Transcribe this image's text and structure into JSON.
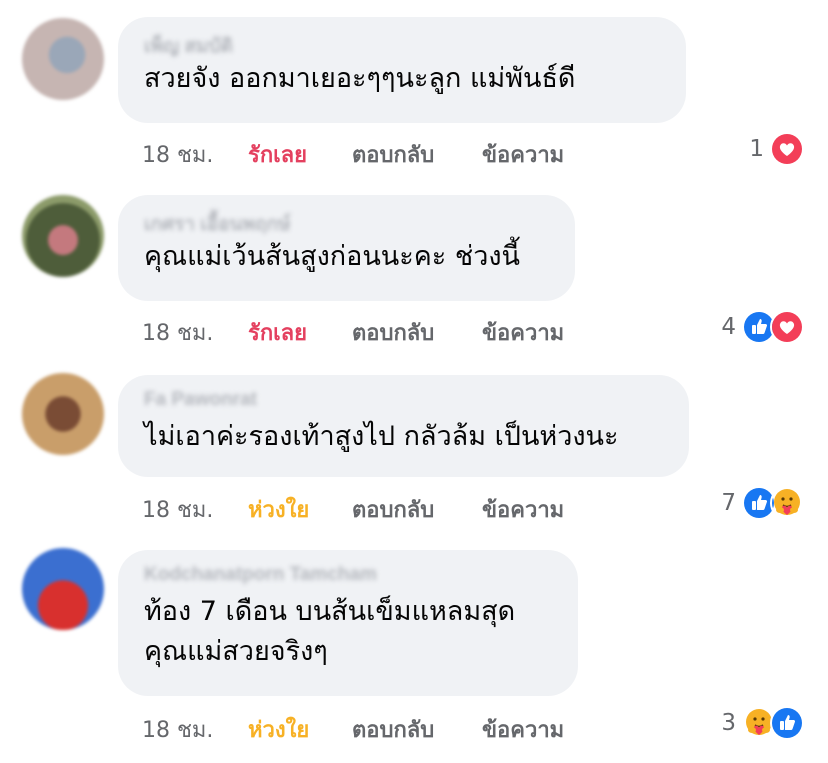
{
  "comments": [
    {
      "author": "เพ็ญ สมบัติ",
      "lines": [
        "สวยจัง   ออกมาเยอะๆๆนะลูก   แม่พันธ์ดี"
      ],
      "time": "18 ชม.",
      "reaction_label": "รักเลย",
      "reply_label": "ตอบกลับ",
      "message_label": "ข้อความ",
      "reaction_count": "1",
      "reaction_icons": [
        "love-icon"
      ],
      "avatar_colors": [
        "#b8a8a6",
        "#8e9aab"
      ]
    },
    {
      "author": "เกศรา เอื้อนพฤกษ์",
      "lines": [
        "คุณแม่เว้นส้นสูงก่อนนะคะ ช่วงนี้"
      ],
      "time": "18 ชม.",
      "reaction_label": "รักเลย",
      "reply_label": "ตอบกลับ",
      "message_label": "ข้อความ",
      "reaction_count": "4",
      "reaction_icons": [
        "like-icon",
        "love-icon"
      ],
      "avatar_colors": [
        "#6b7a4e",
        "#c45a6a"
      ]
    },
    {
      "author": "Fa Pawonrat",
      "lines": [
        "ไม่เอาค่ะรองเท้าสูงไป กลัวล้ม เป็นห่วงนะ"
      ],
      "time": "18 ชม.",
      "reaction_label": "ห่วงใย",
      "reply_label": "ตอบกลับ",
      "message_label": "ข้อความ",
      "reaction_count": "7",
      "reaction_icons": [
        "like-icon",
        "care-icon"
      ],
      "avatar_colors": [
        "#c9a272",
        "#6e4a35"
      ]
    },
    {
      "author": "Kodchanatporn Tamcham",
      "lines": [
        "ท้อง 7 เดือน บนส้นเข็มแหลมสุด",
        "คุณแม่สวยจริงๆ"
      ],
      "time": "18 ชม.",
      "reaction_label": "ห่วงใย",
      "reply_label": "ตอบกลับ",
      "message_label": "ข้อความ",
      "reaction_count": "3",
      "reaction_icons": [
        "care-icon",
        "like-icon"
      ],
      "avatar_colors": [
        "#3b6fd0",
        "#d8302e"
      ]
    }
  ],
  "colors": {
    "love": "#e4405f",
    "care": "#f7b125",
    "like": "#1877f2",
    "bubble": "#f0f2f5",
    "meta": "#65676b"
  }
}
